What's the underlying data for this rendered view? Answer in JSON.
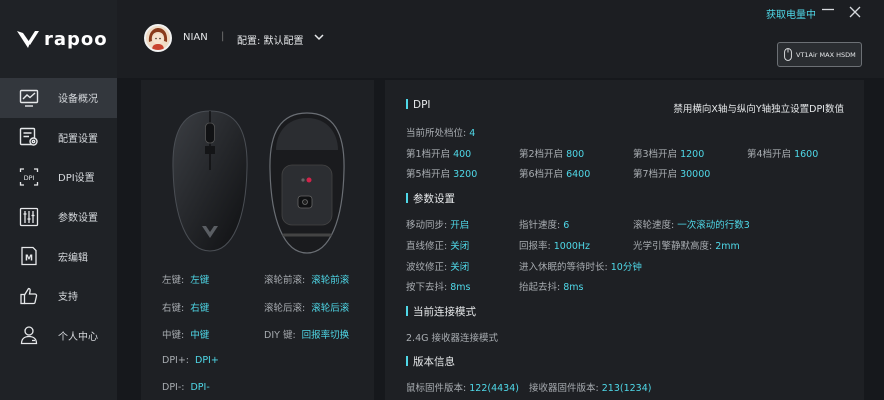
{
  "app": {
    "logo_text": "rapoo",
    "battery_link": "获取电量中"
  },
  "header": {
    "user_name": "NIAN",
    "separator": "|",
    "config_label": "配置: 默认配置",
    "device_name": "VT1Air MAX HSDM"
  },
  "sidebar": {
    "items": [
      {
        "label": "设备概况",
        "icon": "monitor-chart-icon",
        "active": true
      },
      {
        "label": "配置设置",
        "icon": "config-gear-icon",
        "active": false
      },
      {
        "label": "DPI设置",
        "icon": "dpi-icon",
        "active": false
      },
      {
        "label": "参数设置",
        "icon": "sliders-icon",
        "active": false
      },
      {
        "label": "宏编辑",
        "icon": "macro-icon",
        "active": false
      },
      {
        "label": "支持",
        "icon": "thumbs-up-icon",
        "active": false
      },
      {
        "label": "个人中心",
        "icon": "user-icon",
        "active": false
      }
    ]
  },
  "keys": [
    {
      "label": "左键:",
      "value": "左键"
    },
    {
      "label": "滚轮前滚:",
      "value": "滚轮前滚"
    },
    {
      "label": "右键:",
      "value": "右键"
    },
    {
      "label": "滚轮后滚:",
      "value": "滚轮后滚"
    },
    {
      "label": "中键:",
      "value": "中键"
    },
    {
      "label": "DIY 键:",
      "value": "回报率切换"
    },
    {
      "label": "DPI+:",
      "value": "DPI+"
    },
    {
      "label": "DPI-:",
      "value": "DPI-"
    }
  ],
  "dpi": {
    "title": "DPI",
    "note": "禁用横向X轴与纵向Y轴独立设置DPI数值",
    "current_label": "当前所处档位:",
    "current_value": "4",
    "levels": [
      {
        "label": "第1档开启",
        "value": "400"
      },
      {
        "label": "第2档开启",
        "value": "800"
      },
      {
        "label": "第3档开启",
        "value": "1200"
      },
      {
        "label": "第4档开启",
        "value": "1600"
      },
      {
        "label": "第5档开启",
        "value": "3200"
      },
      {
        "label": "第6档开启",
        "value": "6400"
      },
      {
        "label": "第7档开启",
        "value": "30000"
      }
    ]
  },
  "params": {
    "title": "参数设置",
    "items": [
      {
        "label": "移动同步:",
        "value": "开启"
      },
      {
        "label": "指针速度:",
        "value": "6"
      },
      {
        "label": "滚轮速度:",
        "value": "一次滚动的行数3"
      },
      {
        "label": "直线修正:",
        "value": "关闭"
      },
      {
        "label": "回报率:",
        "value": "1000Hz"
      },
      {
        "label": "光学引擎静默高度:",
        "value": "2mm"
      },
      {
        "label": "波纹修正:",
        "value": "关闭"
      },
      {
        "label": "进入休眠的等待时长:",
        "value": "10分钟"
      },
      {
        "label": "按下去抖:",
        "value": "8ms"
      },
      {
        "label": "抬起去抖:",
        "value": "8ms"
      }
    ]
  },
  "connection": {
    "title": "当前连接模式",
    "mode": "2.4G 接收器连接模式"
  },
  "version": {
    "title": "版本信息",
    "mouse_fw_label": "鼠标固件版本:",
    "mouse_fw_value": "122(4434)",
    "receiver_fw_label": "接收器固件版本:",
    "receiver_fw_value": "213(1234)"
  },
  "colors": {
    "accent": "#4fd8e8",
    "background": "#16181c",
    "panel": "#1e2024",
    "sidebar": "#1f2226",
    "active_nav": "#33373d"
  }
}
